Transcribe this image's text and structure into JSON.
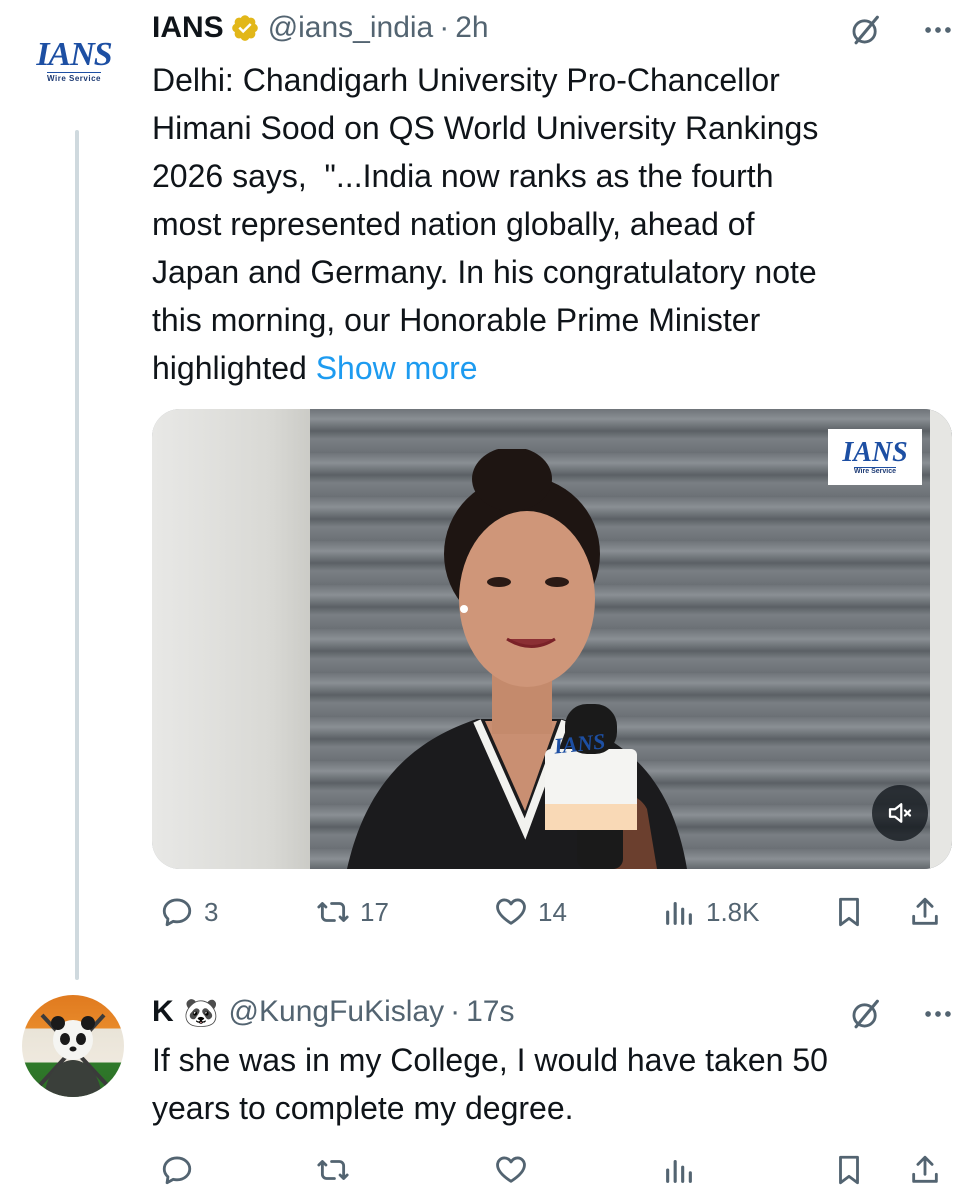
{
  "tweet1": {
    "avatar_logo": "IANS",
    "avatar_sub": "Wire Service",
    "name": "IANS",
    "handle": "@ians_india",
    "separator": "·",
    "time": "2h",
    "text_lines": [
      "Delhi: Chandigarh University Pro-Chancellor",
      "Himani Sood on QS World University Rankings",
      "2026 says,  \"...India now ranks as the fourth",
      "most represented nation globally, ahead of",
      "Japan and Germany. In his congratulatory note",
      "this morning, our Honorable Prime Minister"
    ],
    "last_line": "highlighted",
    "show_more": "Show more",
    "media": {
      "watermark": "IANS",
      "watermark_sub": "Wire Service",
      "mic_label": "IANS"
    },
    "actions": {
      "replies": "3",
      "reposts": "17",
      "likes": "14",
      "views": "1.8K"
    }
  },
  "tweet2": {
    "name": "K",
    "emoji": "🐼",
    "handle": "@KungFuKislay",
    "separator": "·",
    "time": "17s",
    "text_lines": [
      "If she was in my College, I would have taken 50",
      "years to complete my degree."
    ]
  },
  "colors": {
    "accent": "#1d9bf0",
    "secondary_text": "#536471",
    "verified_gold": "#e2b719",
    "thread_line": "#cfd9de"
  },
  "icons": [
    "verified-badge-icon",
    "grok-icon",
    "more-icon",
    "reply-icon",
    "repost-icon",
    "like-icon",
    "views-icon",
    "bookmark-icon",
    "share-icon",
    "mute-icon"
  ]
}
